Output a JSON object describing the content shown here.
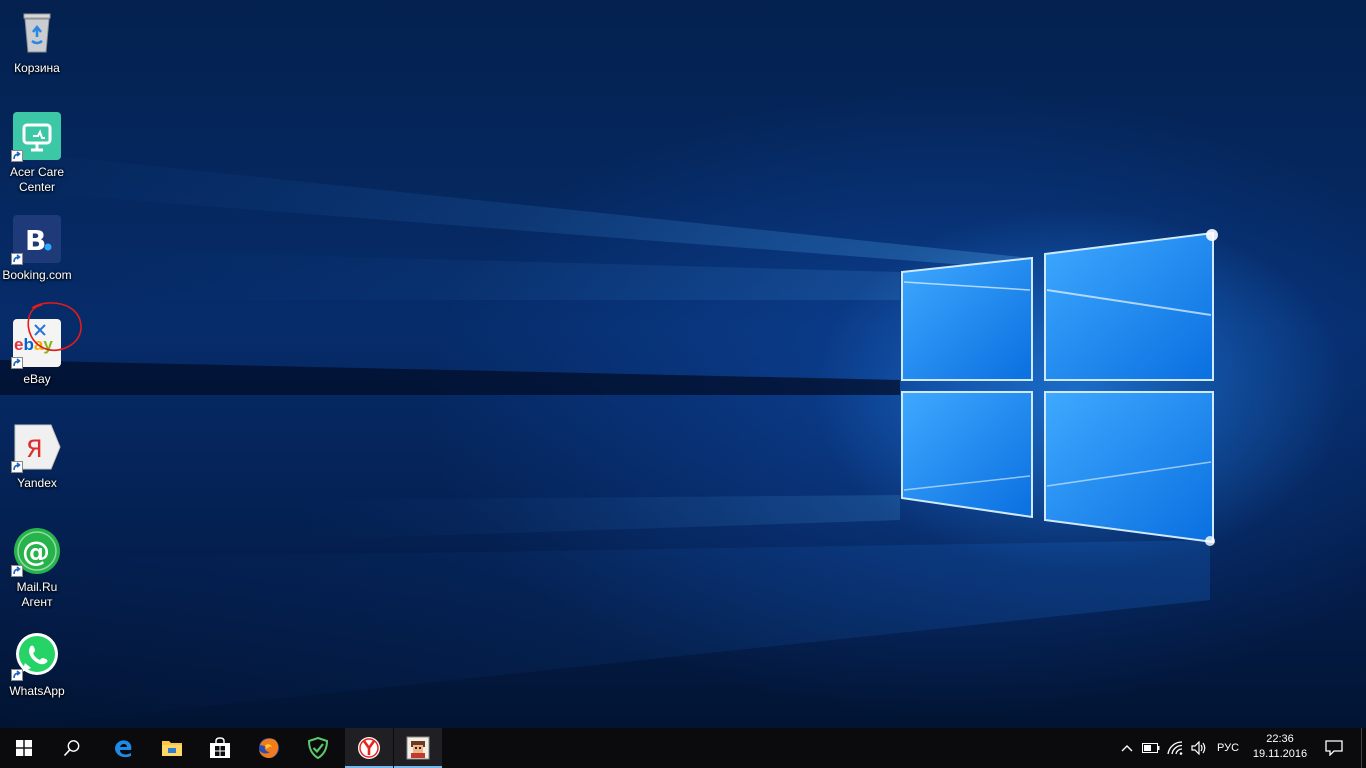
{
  "desktop": {
    "icons": [
      {
        "label": "Корзина",
        "icon": "recycle-bin-icon"
      },
      {
        "label": "Acer Care\nCenter",
        "icon": "acer-care-center-icon"
      },
      {
        "label": "Booking.com",
        "icon": "booking-icon"
      },
      {
        "label": "eBay",
        "icon": "ebay-icon"
      },
      {
        "label": "Yandex",
        "icon": "yandex-icon"
      },
      {
        "label": "Mail.Ru\nАгент",
        "icon": "mail-ru-agent-icon"
      },
      {
        "label": "WhatsApp",
        "icon": "whatsapp-icon"
      }
    ]
  },
  "taskbar": {
    "pinned": [
      "start-icon",
      "search-icon",
      "edge-icon",
      "file-explorer-icon",
      "store-icon",
      "firefox-icon",
      "adguard-icon",
      "yandex-browser-icon",
      "game-app-icon"
    ],
    "tray": {
      "language": "РУС",
      "time": "22:36",
      "date": "19.11.2016"
    }
  },
  "colors": {
    "taskbar_bg": "#0b0b0d",
    "accent": "#76b9ed",
    "wallpaper_light": "#2d8ff5"
  }
}
